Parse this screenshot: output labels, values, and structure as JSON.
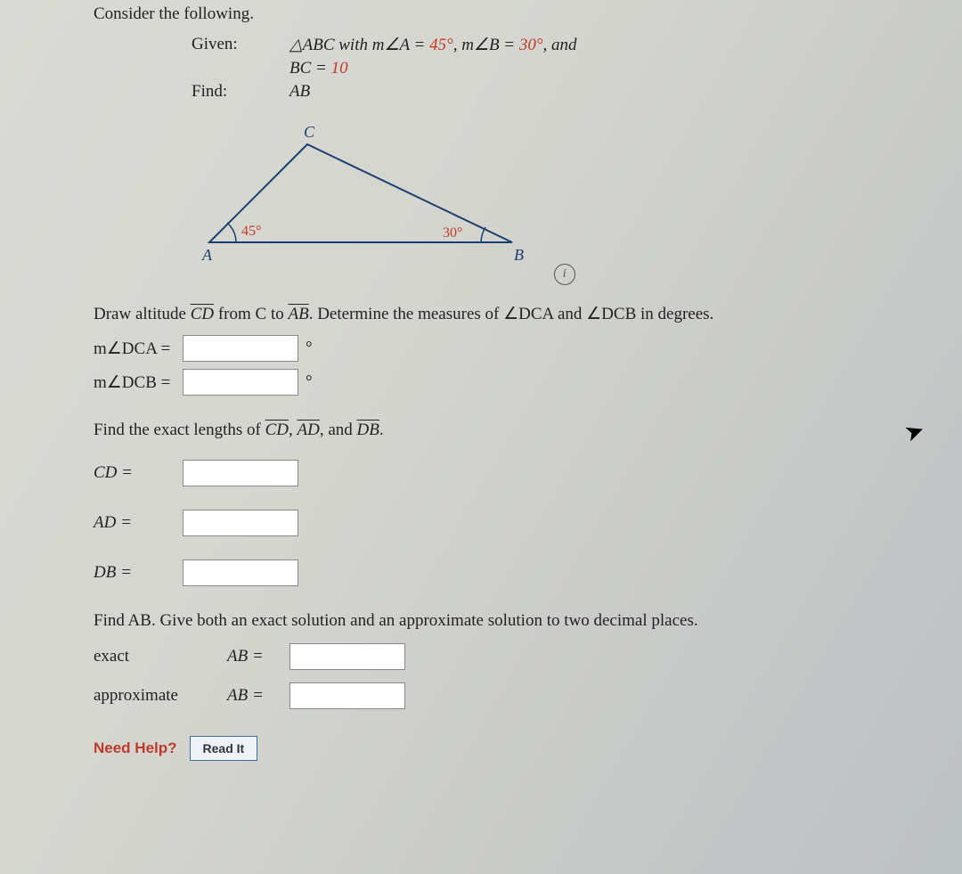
{
  "header": "Consider the following.",
  "given_label": "Given:",
  "find_label": "Find:",
  "given_line1_pre": "△ABC with m∠A = ",
  "given_line1_val1": "45°",
  "given_line1_mid": ", m∠B = ",
  "given_line1_val2": "30°",
  "given_line1_post": ", and",
  "given_line2_pre": "BC = ",
  "given_line2_val": "10",
  "find_value": "AB",
  "triangle": {
    "A": "A",
    "B": "B",
    "C": "C",
    "angA": "45°",
    "angB": "30°"
  },
  "instr1_pre": "Draw altitude ",
  "instr1_cd": "CD",
  "instr1_mid": " from C to ",
  "instr1_ab": "AB",
  "instr1_post": ". Determine the measures of ∠DCA and ∠DCB in degrees.",
  "mdca": "m∠DCA  =",
  "mdcb": "m∠DCB  =",
  "deg_sym": "°",
  "instr2_pre": "Find the exact lengths of ",
  "seg_cd": "CD",
  "sep": ", ",
  "seg_ad": "AD",
  "and": ", and ",
  "seg_db": "DB",
  "period": ".",
  "cd_eq": "CD  =",
  "ad_eq": "AD  =",
  "db_eq": "DB  =",
  "instr3": "Find AB. Give both an exact solution and an approximate solution to two decimal places.",
  "exact": "exact",
  "approx": "approximate",
  "ab_eq": "AB  =",
  "need_help": "Need Help?",
  "read_it": "Read It",
  "info": "i",
  "chart_data": {
    "type": "diagram",
    "shape": "triangle",
    "vertices": [
      "A",
      "B",
      "C"
    ],
    "angles": {
      "A": 45,
      "B": 30
    },
    "given_side": {
      "name": "BC",
      "length": 10
    },
    "altitude": "CD from C to AB",
    "find": "AB"
  }
}
